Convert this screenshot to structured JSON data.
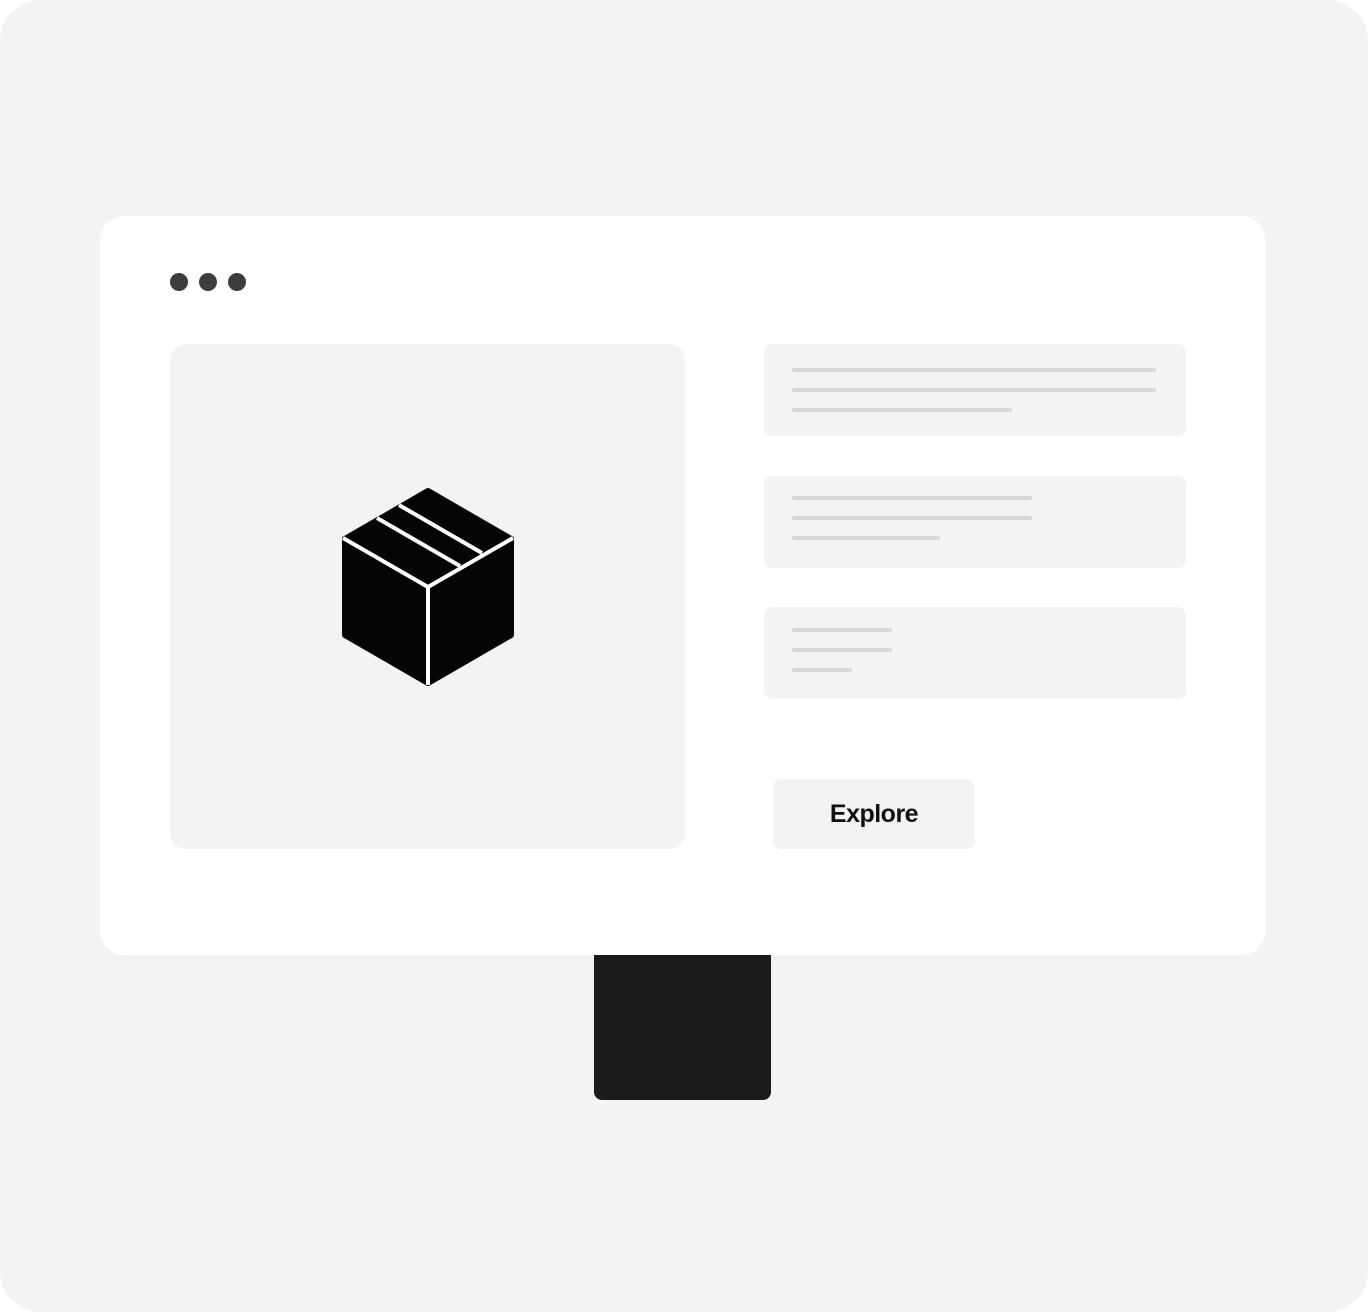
{
  "button": {
    "label": "Explore"
  },
  "icons": {
    "hero": "package-box-icon",
    "window_controls": [
      "window-dot-icon",
      "window-dot-icon",
      "window-dot-icon"
    ]
  },
  "colors": {
    "background": "#f3f3f3",
    "window": "#ffffff",
    "stand": "#1b1b1b",
    "dots": "#3d3d3d",
    "placeholder_lines": "#d8d8d8",
    "icon": "#050505"
  }
}
